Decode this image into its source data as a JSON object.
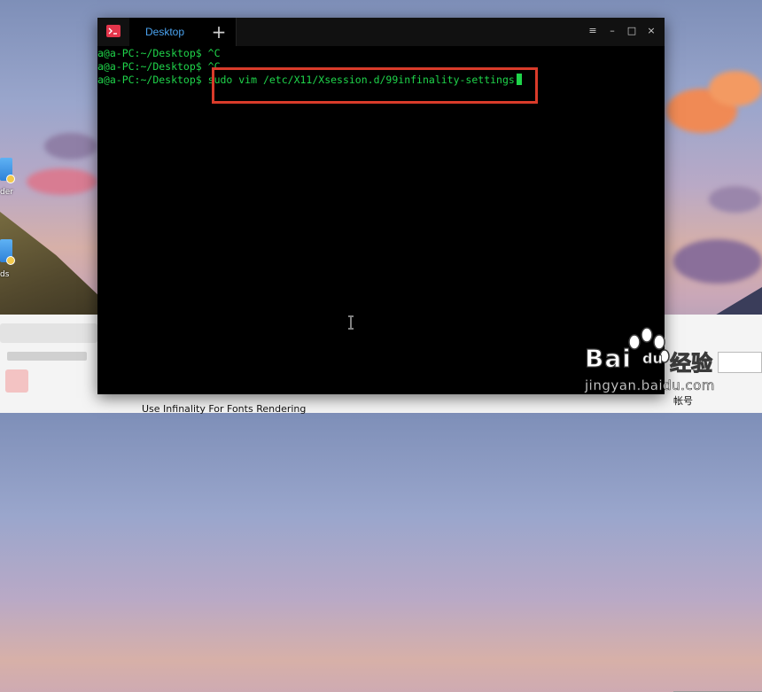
{
  "desktop": {
    "icons": [
      {
        "label": "der"
      },
      {
        "label": "ds"
      }
    ]
  },
  "terminal": {
    "tab_label": "Desktop",
    "new_tab_symbol": "+",
    "window_controls": {
      "menu": "≡",
      "minimize": "–",
      "maximize": "□",
      "close": "×"
    },
    "lines": [
      {
        "user": "a@a-PC",
        "path": ":~/Desktop$",
        "command": " ^C"
      },
      {
        "user": "a@a-PC",
        "path": ":~/Desktop$",
        "command": " ^C"
      },
      {
        "user": "a@a-PC",
        "path": ":~/Desktop$",
        "command": " sudo vim /etc/X11/Xsession.d/99infinality-settings"
      }
    ],
    "text_color": "#1fd44a",
    "highlight_color": "#d93b2a"
  },
  "background_browser": {
    "bottom_text": "Use Infinality For Fonts Rendering",
    "bottom_right_text": "帐号"
  },
  "watermark": {
    "brand_bai": "Bai",
    "brand_du": "du",
    "brand_jingyan": "经验",
    "url": "jingyan.baidu.com"
  }
}
